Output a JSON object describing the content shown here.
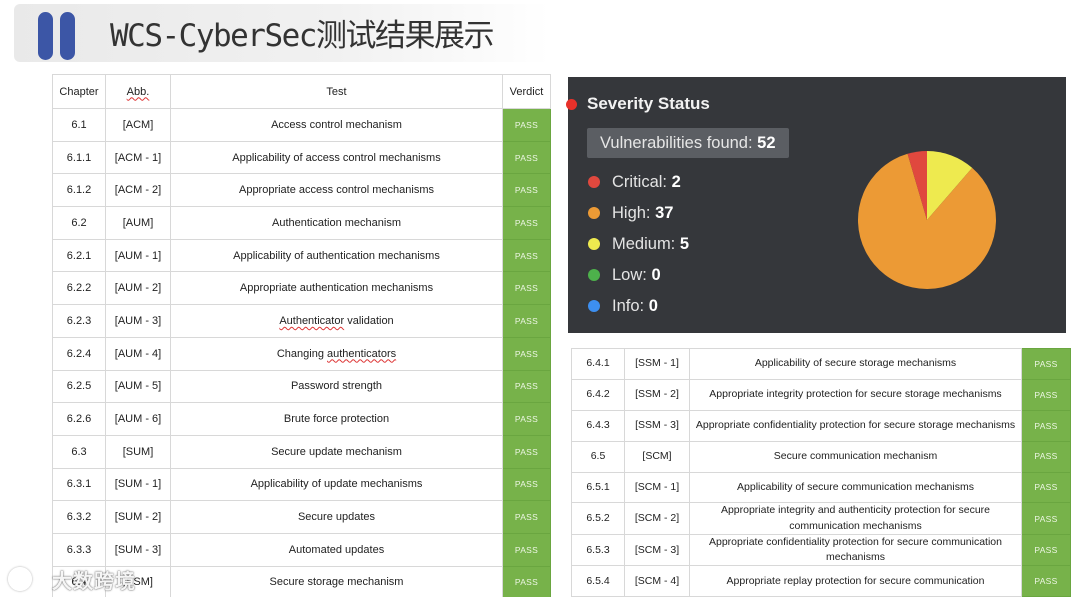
{
  "header": {
    "title": "WCS-CyberSec测试结果展示"
  },
  "left_table": {
    "headers": {
      "chapter": "Chapter",
      "abb": "Abb.",
      "test": "Test",
      "verdict": "Verdict"
    },
    "rows": [
      {
        "chapter": "6.1",
        "abb": "[ACM]",
        "test": "Access control mechanism",
        "verdict": "PASS"
      },
      {
        "chapter": "6.1.1",
        "abb": "[ACM - 1]",
        "test": "Applicability of access control mechanisms",
        "verdict": "PASS"
      },
      {
        "chapter": "6.1.2",
        "abb": "[ACM - 2]",
        "test": "Appropriate access control mechanisms",
        "verdict": "PASS"
      },
      {
        "chapter": "6.2",
        "abb": "[AUM]",
        "test": "Authentication mechanism",
        "verdict": "PASS"
      },
      {
        "chapter": "6.2.1",
        "abb": "[AUM - 1]",
        "test": "Applicability of authentication mechanisms",
        "verdict": "PASS"
      },
      {
        "chapter": "6.2.2",
        "abb": "[AUM - 2]",
        "test": "Appropriate authentication mechanisms",
        "verdict": "PASS"
      },
      {
        "chapter": "6.2.3",
        "abb": "[AUM - 3]",
        "test": "Authenticator validation",
        "verdict": "PASS"
      },
      {
        "chapter": "6.2.4",
        "abb": "[AUM - 4]",
        "test": "Changing authenticators",
        "verdict": "PASS"
      },
      {
        "chapter": "6.2.5",
        "abb": "[AUM - 5]",
        "test": "Password strength",
        "verdict": "PASS"
      },
      {
        "chapter": "6.2.6",
        "abb": "[AUM - 6]",
        "test": "Brute force protection",
        "verdict": "PASS"
      },
      {
        "chapter": "6.3",
        "abb": "[SUM]",
        "test": "Secure update mechanism",
        "verdict": "PASS"
      },
      {
        "chapter": "6.3.1",
        "abb": "[SUM - 1]",
        "test": "Applicability of update mechanisms",
        "verdict": "PASS"
      },
      {
        "chapter": "6.3.2",
        "abb": "[SUM - 2]",
        "test": "Secure updates",
        "verdict": "PASS"
      },
      {
        "chapter": "6.3.3",
        "abb": "[SUM - 3]",
        "test": "Automated updates",
        "verdict": "PASS"
      },
      {
        "chapter": "6.4",
        "abb": "[SSM]",
        "test": "Secure storage mechanism",
        "verdict": "PASS"
      }
    ]
  },
  "severity": {
    "title": "Severity Status",
    "found_label": "Vulnerabilities found:",
    "found_count": "52",
    "items": [
      {
        "label": "Critical:",
        "count": "2",
        "value": 2,
        "color": "#e0483e"
      },
      {
        "label": "High:",
        "count": "37",
        "value": 37,
        "color": "#ec9a35"
      },
      {
        "label": "Medium:",
        "count": "5",
        "value": 5,
        "color": "#eeea4f"
      },
      {
        "label": "Low:",
        "count": "0",
        "value": 0,
        "color": "#4db14b"
      },
      {
        "label": "Info:",
        "count": "0",
        "value": 0,
        "color": "#3d8ff0"
      }
    ]
  },
  "right_table": {
    "rows": [
      {
        "chapter": "6.4.1",
        "abb": "[SSM - 1]",
        "test": "Applicability of secure storage mechanisms",
        "verdict": "PASS"
      },
      {
        "chapter": "6.4.2",
        "abb": "[SSM - 2]",
        "test": "Appropriate integrity protection for secure storage mechanisms",
        "verdict": "PASS"
      },
      {
        "chapter": "6.4.3",
        "abb": "[SSM - 3]",
        "test": "Appropriate confidentiality protection for secure storage mechanisms",
        "verdict": "PASS"
      },
      {
        "chapter": "6.5",
        "abb": "[SCM]",
        "test": "Secure communication mechanism",
        "verdict": "PASS"
      },
      {
        "chapter": "6.5.1",
        "abb": "[SCM - 1]",
        "test": "Applicability of secure communication mechanisms",
        "verdict": "PASS"
      },
      {
        "chapter": "6.5.2",
        "abb": "[SCM - 2]",
        "test": "Appropriate integrity and authenticity protection for secure communication mechanisms",
        "verdict": "PASS"
      },
      {
        "chapter": "6.5.3",
        "abb": "[SCM - 3]",
        "test": "Appropriate confidentiality protection for secure communication mechanisms",
        "verdict": "PASS"
      },
      {
        "chapter": "6.5.4",
        "abb": "[SCM - 4]",
        "test": "Appropriate replay protection for secure communication",
        "verdict": "PASS"
      }
    ]
  },
  "watermark": {
    "text": "大数跨境"
  }
}
